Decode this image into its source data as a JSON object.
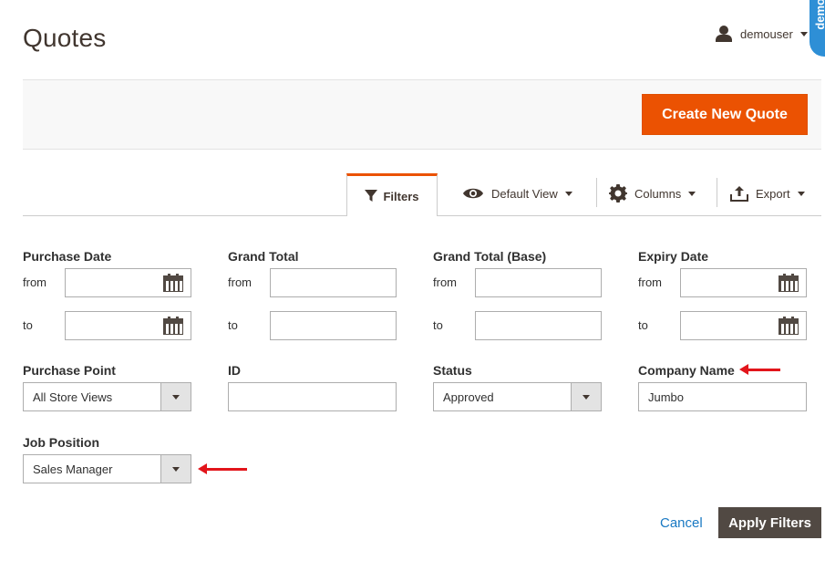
{
  "page": {
    "title": "Quotes"
  },
  "user": {
    "name": "demouser"
  },
  "badge": {
    "label": "demo"
  },
  "actions": {
    "create_label": "Create New Quote"
  },
  "toolbar": {
    "filters_label": "Filters",
    "view_label": "Default View",
    "columns_label": "Columns",
    "export_label": "Export"
  },
  "filters": {
    "purchase_date": {
      "label": "Purchase Date",
      "from_label": "from",
      "to_label": "to",
      "from_value": "",
      "to_value": ""
    },
    "grand_total": {
      "label": "Grand Total",
      "from_label": "from",
      "to_label": "to",
      "from_value": "",
      "to_value": ""
    },
    "grand_total_base": {
      "label": "Grand Total (Base)",
      "from_label": "from",
      "to_label": "to",
      "from_value": "",
      "to_value": ""
    },
    "expiry_date": {
      "label": "Expiry Date",
      "from_label": "from",
      "to_label": "to",
      "from_value": "",
      "to_value": ""
    },
    "purchase_point": {
      "label": "Purchase Point",
      "value": "All Store Views"
    },
    "id": {
      "label": "ID",
      "value": ""
    },
    "status": {
      "label": "Status",
      "value": "Approved"
    },
    "company_name": {
      "label": "Company Name",
      "value": "Jumbo"
    },
    "job_position": {
      "label": "Job Position",
      "value": "Sales Manager"
    }
  },
  "buttons": {
    "cancel_label": "Cancel",
    "apply_label": "Apply Filters"
  },
  "colors": {
    "accent": "#eb5202",
    "annotation_arrow": "#e2151b",
    "link": "#1979c3",
    "apply_bg": "#514943"
  }
}
